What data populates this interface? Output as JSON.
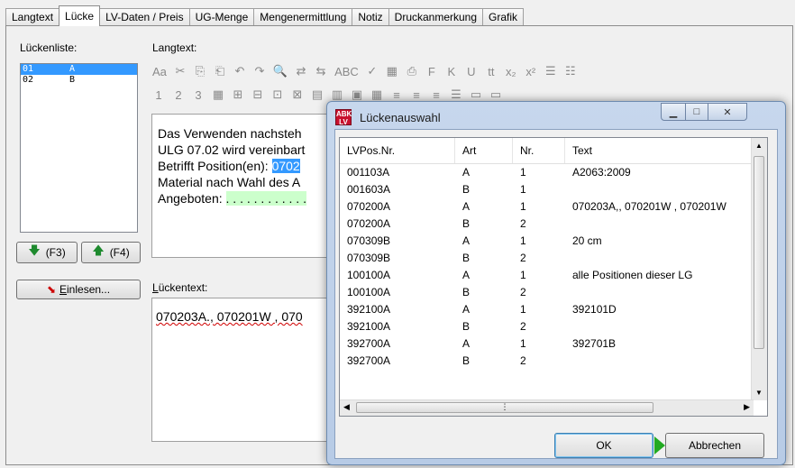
{
  "tabs": [
    "Langtext",
    "Lücke",
    "LV-Daten / Preis",
    "UG-Menge",
    "Mengenermittlung",
    "Notiz",
    "Druckanmerkung",
    "Grafik"
  ],
  "left": {
    "list_label": "Lückenliste:",
    "items": [
      {
        "code": "01",
        "type": "A"
      },
      {
        "code": "02",
        "type": "B"
      }
    ],
    "btn_down": "(F3)",
    "btn_up": "(F4)",
    "read_btn_prefix": "E",
    "read_btn_rest": "inlesen..."
  },
  "editor": {
    "label": "Langtext:",
    "line1": "Das Verwenden nachsteh",
    "line2": "ULG 07.02 wird vereinbart",
    "line3_pre": "Betrifft Position(en): ",
    "line3_hl": "0702",
    "line4": "Material nach Wahl des A",
    "line5_pre": "Angeboten: ",
    "line5_dots": ". . . . . . . . . . . ."
  },
  "toolbar_row1": [
    "Aa",
    "✂",
    "⎘",
    "⎗",
    "↶",
    "↷",
    "🔍",
    "⇄",
    "⇆",
    "ABC",
    "✓",
    "▦",
    "⎙",
    "F",
    "K",
    "U",
    "tt",
    "x₂",
    "x²",
    "☰",
    "☷"
  ],
  "toolbar_row2": [
    "1",
    "2",
    "3",
    "▦",
    "⊞",
    "⊟",
    "⊡",
    "⊠",
    "▤",
    "▥",
    "▣",
    "▦",
    "≡",
    "≡",
    "≡",
    "☰",
    "▭",
    "▭"
  ],
  "gap": {
    "label_prefix": "L",
    "label_rest": "ückentext:",
    "text": "070203A., 070201W , 070"
  },
  "dialog": {
    "icon_text": "ABK LV",
    "title": "Lückenauswahl",
    "columns": [
      "LVPos.Nr.",
      "Art",
      "Nr.",
      "Text"
    ],
    "rows": [
      [
        "001103A",
        "A",
        "1",
        "A2063:2009"
      ],
      [
        "001603A",
        "B",
        "1",
        ""
      ],
      [
        "070200A",
        "A",
        "1",
        "070203A,, 070201W , 070201W"
      ],
      [
        "070200A",
        "B",
        "2",
        ""
      ],
      [
        "070309B",
        "A",
        "1",
        "20 cm"
      ],
      [
        "070309B",
        "B",
        "2",
        ""
      ],
      [
        "100100A",
        "A",
        "1",
        "alle Positionen dieser LG"
      ],
      [
        "100100A",
        "B",
        "2",
        ""
      ],
      [
        "392100A",
        "A",
        "1",
        "392101D"
      ],
      [
        "392100A",
        "B",
        "2",
        ""
      ],
      [
        "392700A",
        "A",
        "1",
        "392701B"
      ],
      [
        "392700A",
        "B",
        "2",
        ""
      ]
    ],
    "ok": "OK",
    "cancel": "Abbrechen"
  },
  "colors": {
    "selection": "#3399ff",
    "green_field": "#ccffcc",
    "accent_arrow": "#22aa22",
    "icon_red": "#c8102e"
  }
}
